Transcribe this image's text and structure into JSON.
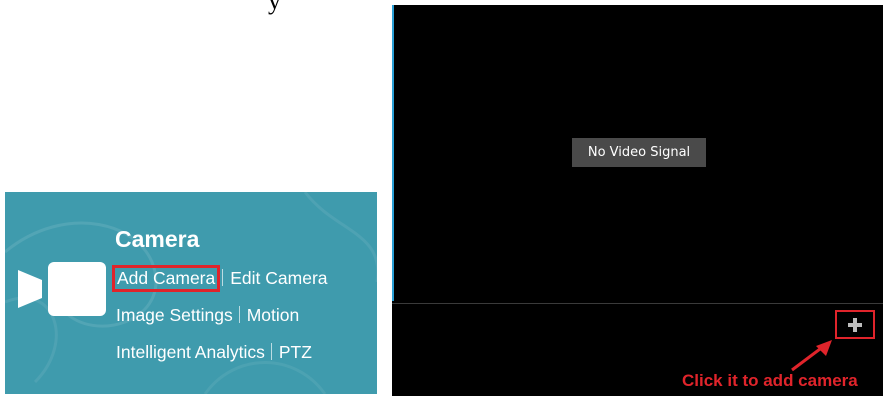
{
  "page": {
    "top_fragment": "y"
  },
  "camera_menu": {
    "title": "Camera",
    "items": {
      "add_camera": "Add Camera",
      "edit_camera": "Edit Camera",
      "image_settings": "Image Settings",
      "motion": "Motion",
      "intelligent_analytics": "Intelligent Analytics",
      "ptz": "PTZ"
    },
    "icon": "video-camera-icon",
    "background_color": "#3f9bad"
  },
  "video_view": {
    "status": "No Video Signal",
    "add_button_icon": "plus-icon",
    "callout": "Click it to add camera",
    "highlight_color": "#e0242b"
  }
}
